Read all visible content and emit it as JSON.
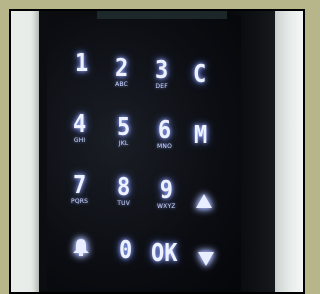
{
  "keypad": {
    "row1": [
      {
        "key": "1",
        "letters": ""
      },
      {
        "key": "2",
        "letters": "ABC"
      },
      {
        "key": "3",
        "letters": "DEF"
      },
      {
        "key": "C",
        "letters": ""
      }
    ],
    "row2": [
      {
        "key": "4",
        "letters": "GHI"
      },
      {
        "key": "5",
        "letters": "JKL"
      },
      {
        "key": "6",
        "letters": "MNO"
      },
      {
        "key": "M",
        "letters": ""
      }
    ],
    "row3": [
      {
        "key": "7",
        "letters": "PQRS"
      },
      {
        "key": "8",
        "letters": "TUV"
      },
      {
        "key": "9",
        "letters": "WXYZ"
      },
      {
        "key": "up-arrow",
        "letters": ""
      }
    ],
    "row4": [
      {
        "key": "bell",
        "letters": ""
      },
      {
        "key": "0",
        "letters": ""
      },
      {
        "key": "OK",
        "letters": ""
      },
      {
        "key": "down-arrow",
        "letters": ""
      }
    ]
  },
  "colors": {
    "backlight": "#9cb0ff",
    "panel": "#0b0d12",
    "border": "#b7b58a"
  }
}
